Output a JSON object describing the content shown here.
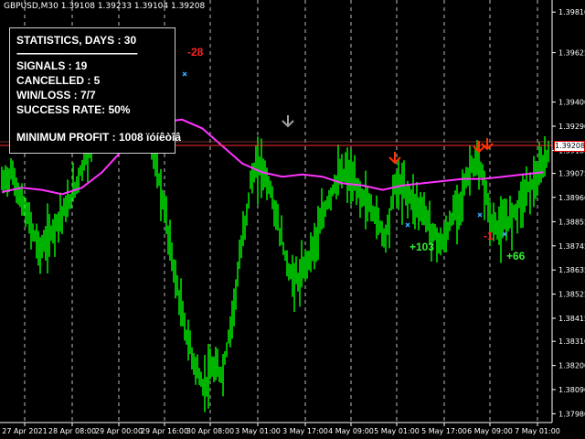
{
  "header": {
    "symbol_info": "GBPUSD,M30  1.39108 1.39233 1.39104 1.39208"
  },
  "stats": {
    "title": "STATISTICS, DAYS : 30",
    "separator": "--------------------------------------------",
    "signals": "SIGNALS : 19",
    "cancelled": "CANCELLED : 5",
    "winloss": "WIN/LOSS : 7/7",
    "success": "SUCCESS RATE: 50%",
    "profit": "MINIMUM PROFIT : 1008 ïóíêòîâ"
  },
  "current_price": "1.39208",
  "annotations": {
    "loss1": "-28",
    "win1": "+103",
    "loss2": "-1",
    "win2": "+66"
  },
  "colors": {
    "candles": "#00e000",
    "ma": "#ff33ff",
    "price_line": "#ff2a2a",
    "arrow_sell": "#ff3300",
    "arrow_grey": "#a0a0a0",
    "cross": "#33aaff",
    "loss_text": "#ff2222",
    "win_text": "#33ee33"
  },
  "chart_data": {
    "type": "line",
    "price_ticks": [
      "1.39810",
      "1.39625",
      "1.39400",
      "1.39290",
      "1.39180",
      "1.39075",
      "1.38966",
      "1.38855",
      "1.38745",
      "1.38635",
      "1.38525",
      "1.38415",
      "1.38310",
      "1.38200",
      "1.38090",
      "1.37980"
    ],
    "time_ticks": [
      "27 Apr 2021",
      "28 Apr 08:00",
      "29 Apr 00:00",
      "29 Apr 16:00",
      "30 Apr 08:00",
      "3 May 01:00",
      "3 May 17:00",
      "4 May 09:00",
      "5 May 01:00",
      "5 May 17:00",
      "6 May 09:00",
      "7 May 01:00"
    ],
    "ylim": [
      1.3794,
      1.39865
    ],
    "close": [
      1.3903,
      1.3908,
      1.3895,
      1.3884,
      1.3872,
      1.3879,
      1.3888,
      1.3893,
      1.3906,
      1.3918,
      1.393,
      1.3936,
      1.3934,
      1.3928,
      1.3944,
      1.3935,
      1.3914,
      1.389,
      1.3862,
      1.3838,
      1.3822,
      1.381,
      1.3818,
      1.3816,
      1.3842,
      1.3874,
      1.3905,
      1.3912,
      1.39,
      1.388,
      1.3862,
      1.3858,
      1.387,
      1.388,
      1.3895,
      1.3905,
      1.3908,
      1.39,
      1.3895,
      1.3888,
      1.3878,
      1.3903,
      1.39,
      1.3895,
      1.389,
      1.388,
      1.3875,
      1.3888,
      1.3898,
      1.3912,
      1.3908,
      1.3885,
      1.3882,
      1.3887,
      1.3895,
      1.3902,
      1.3905,
      1.3918
    ],
    "ma": [
      1.3899,
      1.3901,
      1.39,
      1.3898,
      1.3901,
      1.3908,
      1.3918,
      1.3926,
      1.3931,
      1.3932,
      1.3928,
      1.392,
      1.3912,
      1.3908,
      1.3906,
      1.3907,
      1.3906,
      1.3903,
      1.3902,
      1.39,
      1.3902,
      1.3903,
      1.3904,
      1.3905,
      1.3905,
      1.3906,
      1.3907,
      1.3908
    ]
  }
}
